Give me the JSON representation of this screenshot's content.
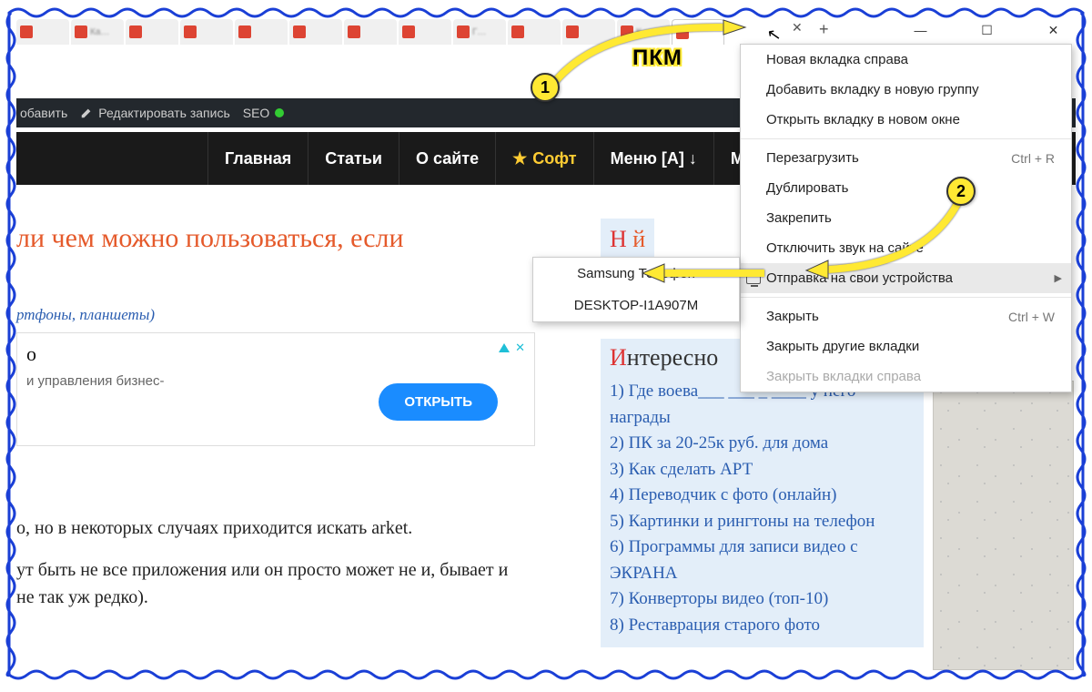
{
  "window_controls": {
    "minimize": "—",
    "maximize": "☐",
    "close": "✕"
  },
  "tab_strip": {
    "close_x": "✕",
    "newtab": "+"
  },
  "admin_bar": {
    "add": "обавить",
    "edit": "Редактировать запись",
    "seo": "SEO"
  },
  "nav": {
    "home": "Главная",
    "articles": "Статьи",
    "about": "О сайте",
    "soft": "Софт",
    "menu_a": "Меню [А] ↓",
    "menu_m": "М"
  },
  "page": {
    "title": "ли чем можно пользоваться, если",
    "subtitle": "ртфоны, планшеты)",
    "body1": "о, но в некоторых случаях приходится искать arket.",
    "body2": "ут быть не все приложения или он просто может не и, бывает и не так уж редко)."
  },
  "ad": {
    "heading": "о",
    "sub": "и управления бизнес-",
    "button": "ОТКРЫТЬ",
    "close": "✕"
  },
  "sidebar": {
    "heading_cut": "Н   й",
    "heading2": "Интересно",
    "items": [
      "1) Где воева___ ___ _ ____ у него награды",
      "2) ПК за 20-25к руб. для дома",
      "3) Как сделать АРТ",
      "4) Переводчик с фото (онлайн)",
      "5) Картинки и рингтоны на телефон",
      "6) Программы для записи видео с ЭКРАНА",
      "7) Конверторы видео (топ-10)",
      "8) Реставрация старого фото"
    ]
  },
  "context_menu": {
    "items": [
      {
        "label": "Новая вкладка справа"
      },
      {
        "label": "Добавить вкладку в новую группу"
      },
      {
        "label": "Открыть вкладку в новом окне"
      },
      {
        "sep": true
      },
      {
        "label": "Перезагрузить",
        "shortcut": "Ctrl + R"
      },
      {
        "label": "Дублировать"
      },
      {
        "label": "Закрепить"
      },
      {
        "label": "Отключить звук на сайте"
      },
      {
        "label": "Отправка на свои устройства",
        "submenu": true,
        "hover": true,
        "icon": true
      },
      {
        "sep": true
      },
      {
        "label": "Закрыть",
        "shortcut": "Ctrl + W"
      },
      {
        "label": "Закрыть другие вкладки"
      },
      {
        "label": "Закрыть вкладки справа",
        "disabled": true
      }
    ]
  },
  "submenu": {
    "items": [
      "Samsung Телефон",
      "DESKTOP-I1A907M"
    ]
  },
  "annotations": {
    "label": "ПКМ",
    "badge1": "1",
    "badge2": "2"
  }
}
